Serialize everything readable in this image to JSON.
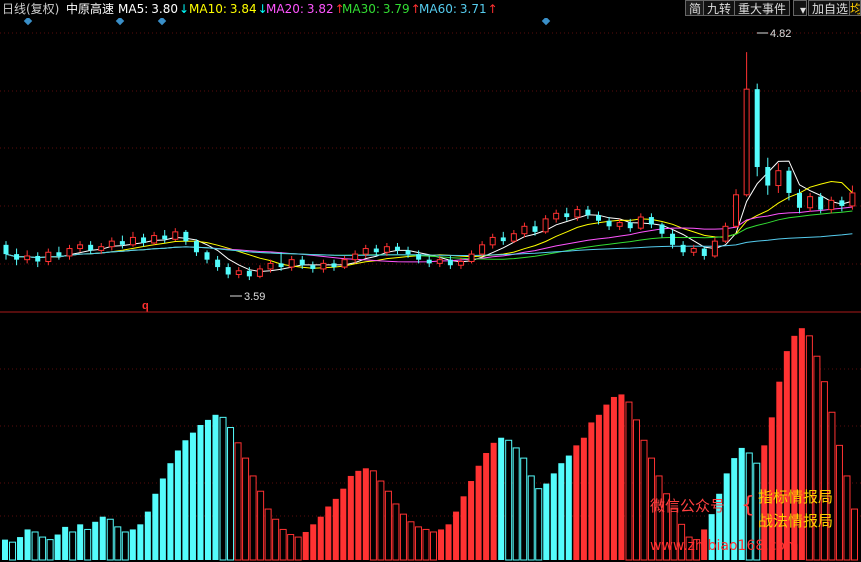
{
  "header": {
    "period": "日线(复权)",
    "stock_name": "中原高速",
    "ma": [
      {
        "label": "MA5:",
        "value": "3.80",
        "dir": "down",
        "color": "#ffffff"
      },
      {
        "label": "MA10:",
        "value": "3.84",
        "dir": "down",
        "color": "#ffff00"
      },
      {
        "label": "MA20:",
        "value": "3.82",
        "dir": "up",
        "color": "#ff55ff"
      },
      {
        "label": "MA30:",
        "value": "3.79",
        "dir": "up",
        "color": "#33dd33"
      },
      {
        "label": "MA60:",
        "value": "3.71",
        "dir": "up",
        "color": "#55ccee"
      }
    ],
    "arrow_up_color": "#ff3030",
    "arrow_down_color": "#00ffff"
  },
  "toolbar": {
    "simple": "简",
    "jiuzhuan": "九转",
    "events": "重大事件",
    "add": "加自选",
    "more": "均"
  },
  "annotations": {
    "high": "4.82",
    "low": "3.59",
    "marker": "q"
  },
  "watermark": {
    "line1": "微信公众号",
    "bracket": "{",
    "line2": "指标情报局",
    "line3": "战法情报局",
    "url": "www.zhibiao168.com"
  },
  "colors": {
    "up": "#ff3232",
    "down": "#54fcfc",
    "grid": "#7a1010",
    "divider": "#aa1a1a"
  },
  "chart_data": {
    "type": "candlestick",
    "price_range": [
      3.45,
      4.95
    ],
    "candles": [
      [
        3.78,
        3.73,
        3.8,
        3.7
      ],
      [
        3.73,
        3.7,
        3.76,
        3.67
      ],
      [
        3.7,
        3.72,
        3.75,
        3.68
      ],
      [
        3.72,
        3.69,
        3.74,
        3.66
      ],
      [
        3.69,
        3.74,
        3.76,
        3.67
      ],
      [
        3.74,
        3.72,
        3.77,
        3.7
      ],
      [
        3.72,
        3.76,
        3.78,
        3.7
      ],
      [
        3.76,
        3.78,
        3.8,
        3.74
      ],
      [
        3.78,
        3.75,
        3.8,
        3.73
      ],
      [
        3.75,
        3.77,
        3.79,
        3.73
      ],
      [
        3.77,
        3.8,
        3.82,
        3.75
      ],
      [
        3.8,
        3.78,
        3.83,
        3.76
      ],
      [
        3.78,
        3.82,
        3.85,
        3.77
      ],
      [
        3.82,
        3.79,
        3.84,
        3.77
      ],
      [
        3.79,
        3.83,
        3.85,
        3.78
      ],
      [
        3.83,
        3.81,
        3.86,
        3.79
      ],
      [
        3.81,
        3.85,
        3.87,
        3.8
      ],
      [
        3.85,
        3.8,
        3.86,
        3.78
      ],
      [
        3.8,
        3.74,
        3.81,
        3.72
      ],
      [
        3.74,
        3.7,
        3.75,
        3.68
      ],
      [
        3.7,
        3.66,
        3.72,
        3.64
      ],
      [
        3.66,
        3.62,
        3.68,
        3.6
      ],
      [
        3.62,
        3.64,
        3.66,
        3.6
      ],
      [
        3.64,
        3.61,
        3.66,
        3.59
      ],
      [
        3.61,
        3.65,
        3.67,
        3.6
      ],
      [
        3.65,
        3.68,
        3.7,
        3.63
      ],
      [
        3.68,
        3.66,
        3.74,
        3.64
      ],
      [
        3.66,
        3.7,
        3.72,
        3.64
      ],
      [
        3.7,
        3.67,
        3.72,
        3.65
      ],
      [
        3.67,
        3.65,
        3.69,
        3.63
      ],
      [
        3.65,
        3.68,
        3.7,
        3.63
      ],
      [
        3.68,
        3.66,
        3.7,
        3.64
      ],
      [
        3.66,
        3.7,
        3.72,
        3.65
      ],
      [
        3.7,
        3.73,
        3.75,
        3.68
      ],
      [
        3.73,
        3.76,
        3.78,
        3.71
      ],
      [
        3.76,
        3.74,
        3.78,
        3.72
      ],
      [
        3.74,
        3.77,
        3.79,
        3.72
      ],
      [
        3.77,
        3.75,
        3.79,
        3.73
      ],
      [
        3.75,
        3.73,
        3.77,
        3.71
      ],
      [
        3.73,
        3.7,
        3.75,
        3.68
      ],
      [
        3.7,
        3.68,
        3.72,
        3.66
      ],
      [
        3.68,
        3.7,
        3.72,
        3.66
      ],
      [
        3.7,
        3.67,
        3.72,
        3.65
      ],
      [
        3.67,
        3.69,
        3.71,
        3.65
      ],
      [
        3.69,
        3.73,
        3.75,
        3.68
      ],
      [
        3.73,
        3.78,
        3.8,
        3.72
      ],
      [
        3.78,
        3.82,
        3.84,
        3.76
      ],
      [
        3.82,
        3.8,
        3.85,
        3.78
      ],
      [
        3.8,
        3.84,
        3.86,
        3.79
      ],
      [
        3.84,
        3.88,
        3.9,
        3.82
      ],
      [
        3.88,
        3.85,
        3.91,
        3.83
      ],
      [
        3.85,
        3.92,
        3.94,
        3.84
      ],
      [
        3.92,
        3.95,
        3.97,
        3.9
      ],
      [
        3.95,
        3.93,
        3.98,
        3.91
      ],
      [
        3.93,
        3.97,
        3.99,
        3.91
      ],
      [
        3.97,
        3.94,
        3.99,
        3.92
      ],
      [
        3.94,
        3.91,
        3.96,
        3.89
      ],
      [
        3.91,
        3.88,
        3.93,
        3.86
      ],
      [
        3.88,
        3.9,
        3.92,
        3.86
      ],
      [
        3.9,
        3.87,
        3.92,
        3.85
      ],
      [
        3.87,
        3.93,
        3.95,
        3.86
      ],
      [
        3.93,
        3.89,
        3.95,
        3.87
      ],
      [
        3.89,
        3.84,
        3.9,
        3.82
      ],
      [
        3.84,
        3.78,
        3.86,
        3.76
      ],
      [
        3.78,
        3.74,
        3.8,
        3.72
      ],
      [
        3.74,
        3.76,
        3.78,
        3.72
      ],
      [
        3.76,
        3.72,
        3.77,
        3.7
      ],
      [
        3.72,
        3.8,
        3.82,
        3.71
      ],
      [
        3.8,
        3.88,
        3.9,
        3.79
      ],
      [
        3.88,
        4.05,
        4.08,
        3.87
      ],
      [
        4.05,
        4.62,
        4.82,
        4.04
      ],
      [
        4.62,
        4.2,
        4.65,
        4.15
      ],
      [
        4.2,
        4.1,
        4.25,
        4.05
      ],
      [
        4.1,
        4.18,
        4.22,
        4.06
      ],
      [
        4.18,
        4.06,
        4.2,
        4.02
      ],
      [
        4.06,
        3.98,
        4.08,
        3.95
      ],
      [
        3.98,
        4.04,
        4.06,
        3.96
      ],
      [
        4.04,
        3.97,
        4.06,
        3.95
      ],
      [
        3.97,
        4.02,
        4.04,
        3.95
      ],
      [
        4.02,
        3.99,
        4.04,
        3.96
      ],
      [
        3.99,
        4.06,
        4.1,
        3.97
      ]
    ],
    "lower_indicator": [
      8,
      7,
      9,
      12,
      11,
      9,
      8,
      10,
      13,
      11,
      14,
      12,
      15,
      17,
      16,
      13,
      11,
      12,
      14,
      19,
      26,
      32,
      38,
      43,
      47,
      50,
      53,
      55,
      57,
      56,
      52,
      46,
      40,
      33,
      27,
      20,
      16,
      12,
      10,
      9,
      11,
      14,
      17,
      21,
      24,
      28,
      33,
      35,
      36,
      35,
      31,
      27,
      22,
      18,
      15,
      13,
      12,
      11,
      12,
      14,
      19,
      25,
      31,
      37,
      42,
      46,
      48,
      47,
      44,
      40,
      33,
      28,
      30,
      34,
      38,
      41,
      45,
      48,
      54,
      57,
      61,
      64,
      65,
      62,
      55,
      47,
      40,
      33,
      26,
      20,
      14,
      9,
      8,
      12,
      18,
      26,
      34,
      40,
      44,
      42,
      38,
      45,
      56,
      70,
      82,
      88,
      91,
      88,
      80,
      70,
      58,
      45,
      33,
      20
    ]
  }
}
